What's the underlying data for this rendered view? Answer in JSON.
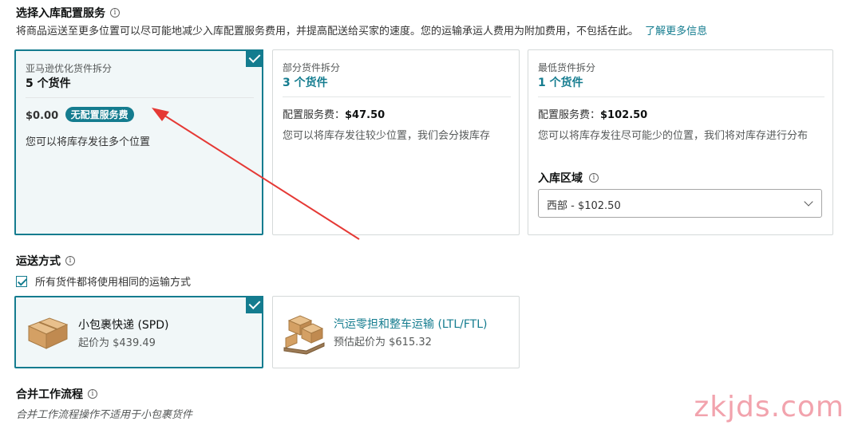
{
  "section_inbound": {
    "title": "选择入库配置服务",
    "description": "将商品运送至更多位置可以尽可能地减少入库配置服务费用，并提高配送给买家的速度。您的运输承运人费用为附加费用，不包括在此。",
    "learn_more": "了解更多信息"
  },
  "options": [
    {
      "label": "亚马逊优化货件拆分",
      "count": "5 个货件",
      "fee": "$0.00",
      "badge": "无配置服务费",
      "note": "您可以将库存发往多个位置"
    },
    {
      "label": "部分货件拆分",
      "count": "3 个货件",
      "fee_label": "配置服务费：",
      "fee_value": "$47.50",
      "note": "您可以将库存发往较少位置，我们会分拨库存"
    },
    {
      "label": "最低货件拆分",
      "count": "1 个货件",
      "fee_label": "配置服务费：",
      "fee_value": "$102.50",
      "note": "您可以将库存发往尽可能少的位置，我们将对库存进行分布",
      "region_label": "入库区域",
      "region_value": "西部 - $102.50"
    }
  ],
  "shipping": {
    "title": "运送方式",
    "checkbox_label": "所有货件都将使用相同的运输方式",
    "methods": [
      {
        "name": "小包裹快递 (SPD)",
        "price": "起价为 $439.49"
      },
      {
        "name": "汽运零担和整车运输 (LTL/FTL)",
        "price": "预估起价为 $615.32"
      }
    ]
  },
  "merge": {
    "title": "合并工作流程",
    "note": "合并工作流程操作不适用于小包裹货件"
  },
  "watermark": "zkjds.com",
  "colors": {
    "accent": "#147c8f",
    "annotation_arrow": "#e53935",
    "watermark": "#f2a3ad"
  }
}
